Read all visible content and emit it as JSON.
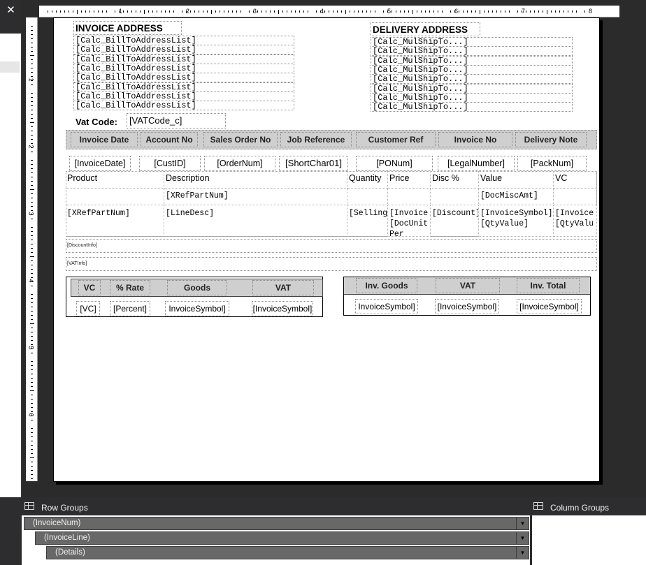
{
  "toolbar": {
    "close_label": "✕"
  },
  "ruler": {
    "h_numbers": [
      "1",
      "2",
      "3",
      "4",
      "5",
      "6",
      "7",
      "8"
    ],
    "v_numbers": [
      "1",
      "2",
      "3",
      "4",
      "5",
      "6"
    ]
  },
  "invoice_address": {
    "title": "INVOICE ADDRESS",
    "lines": [
      "[Calc_BillToAddressList]",
      "[Calc_BillToAddressList]",
      "[Calc_BillToAddressList]",
      "[Calc_BillToAddressList]",
      "[Calc_BillToAddressList]",
      "[Calc_BillToAddressList]",
      "[Calc_BillToAddressList]",
      "[Calc_BillToAddressList]"
    ]
  },
  "delivery_address": {
    "title": "DELIVERY ADDRESS",
    "lines": [
      "[Calc_MulShipTo...]",
      "[Calc_MulShipTo...]",
      "[Calc_MulShipTo...]",
      "[Calc_MulShipTo...]",
      "[Calc_MulShipTo...]",
      "[Calc_MulShipTo...]",
      "[Calc_MulShipTo...]",
      "[Calc_MulShipTo...]"
    ]
  },
  "vat": {
    "label": "Vat Code:",
    "value": "[VATCode_c]"
  },
  "header_fields": {
    "labels": [
      "Invoice Date",
      "Account No",
      "Sales Order No",
      "Job Reference",
      "Customer Ref",
      "Invoice No",
      "Delivery Note"
    ],
    "values": [
      "[InvoiceDate]",
      "[CustID]",
      "[OrderNum]",
      "[ShortChar01]",
      "[PONum]",
      "[LegalNumber]",
      "[PackNum]"
    ]
  },
  "line_table": {
    "columns": [
      "Product",
      "Description",
      "Quantity",
      "Price",
      "Disc %",
      "Value",
      "VC"
    ],
    "misc_row": [
      "",
      "[XRefPartNum]",
      "",
      "",
      "",
      "[DocMiscAmt]",
      ""
    ],
    "detail_row": [
      "[XRefPartNum]",
      "[LineDesc]",
      "[Selling",
      "[Invoice\n[DocUnit\nPer",
      "[Discount]",
      "[InvoiceSymbol]\n[QtyValue]",
      "[Invoice\n[QtyValu"
    ]
  },
  "info_rows": {
    "discount": "[DiscountInfo]",
    "vat": "[VATInfo]"
  },
  "vat_summary": {
    "columns": [
      "VC",
      "% Rate",
      "Goods",
      "VAT"
    ],
    "values": [
      "[VC]",
      "[Percent]",
      "InvoiceSymbol]",
      "[InvoiceSymbol]"
    ]
  },
  "totals": {
    "columns": [
      "Inv. Goods",
      "VAT",
      "Inv. Total"
    ],
    "values": [
      "InvoiceSymbol]",
      "[InvoiceSymbol]",
      "[InvoiceSymbol]"
    ]
  },
  "row_groups": {
    "title": "Row Groups",
    "items": [
      "(InvoiceNum)",
      "(InvoiceLine)",
      "(Details)"
    ]
  },
  "column_groups": {
    "title": "Column Groups"
  },
  "colors": {
    "canvas_bg": "#2b2b2b",
    "header_fill": "#cfcfcf",
    "group_fill": "#686868"
  }
}
